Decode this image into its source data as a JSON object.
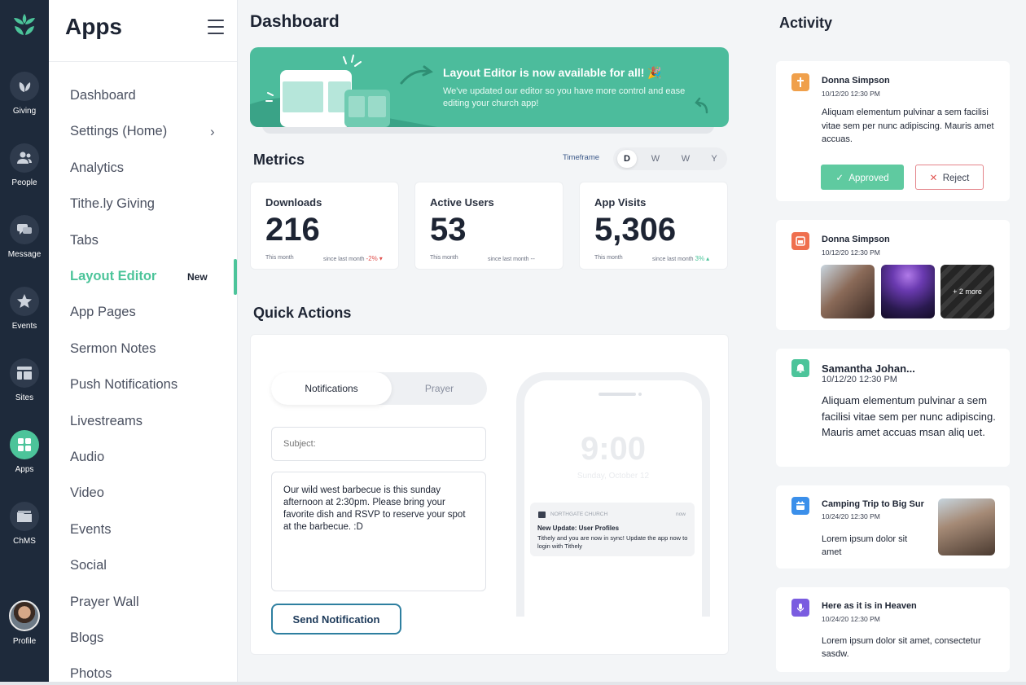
{
  "rail": {
    "items": [
      {
        "label": "Giving",
        "icon": "giving-leaf-icon"
      },
      {
        "label": "People",
        "icon": "people-icon"
      },
      {
        "label": "Message",
        "icon": "message-icon"
      },
      {
        "label": "Events",
        "icon": "events-star-icon"
      },
      {
        "label": "Sites",
        "icon": "sites-icon"
      },
      {
        "label": "Apps",
        "icon": "apps-grid-icon"
      },
      {
        "label": "ChMS",
        "icon": "chms-folder-icon"
      },
      {
        "label": "Profile",
        "icon": "profile-avatar"
      }
    ],
    "active": "Apps"
  },
  "sidebar": {
    "title": "Apps",
    "items": [
      {
        "label": "Dashboard"
      },
      {
        "label": "Settings (Home)",
        "chevron": "›"
      },
      {
        "label": "Analytics"
      },
      {
        "label": "Tithe.ly Giving"
      },
      {
        "label": "Tabs"
      },
      {
        "label": "Layout Editor",
        "badge": "New"
      },
      {
        "label": "App Pages"
      },
      {
        "label": "Sermon Notes"
      },
      {
        "label": "Push Notifications"
      },
      {
        "label": "Livestreams"
      },
      {
        "label": "Audio"
      },
      {
        "label": "Video"
      },
      {
        "label": "Events"
      },
      {
        "label": "Social"
      },
      {
        "label": "Prayer Wall"
      },
      {
        "label": "Blogs"
      },
      {
        "label": "Photos"
      }
    ],
    "active": "Layout Editor"
  },
  "main": {
    "title": "Dashboard",
    "banner": {
      "title": "Layout Editor is now available for all! 🎉",
      "text": "We've updated our editor so you have more control and ease editing your church app!"
    },
    "metrics": {
      "title": "Metrics",
      "timeframe_label": "Timeframe",
      "timeframe_options": [
        "D",
        "W",
        "W",
        "Y"
      ],
      "timeframe_selected": "D",
      "cards": [
        {
          "title": "Downloads",
          "value": "216",
          "note": "This month",
          "since": "since last month",
          "delta": "-2%",
          "arrow": "▾",
          "trend": "down"
        },
        {
          "title": "Active Users",
          "value": "53",
          "note": "This month",
          "since": "since last month",
          "delta": "",
          "arrow": "--",
          "trend": "flat"
        },
        {
          "title": "App Visits",
          "value": "5,306",
          "note": "This month",
          "since": "since last month",
          "delta": "3%",
          "arrow": "▴",
          "trend": "up"
        }
      ]
    },
    "quick_actions": {
      "title": "Quick Actions",
      "tabs": [
        "Notifications",
        "Prayer"
      ],
      "selected_tab": "Notifications",
      "subject_placeholder": "Subject:",
      "message": "Our wild west barbecue is this sunday afternoon at 2:30pm. Please bring your favorite dish and RSVP to reserve your spot at the barbecue. :D",
      "send_label": "Send Notification",
      "preview": {
        "clock": "9:00",
        "date": "Sunday, October 12",
        "church": "NORTHGATE CHURCH",
        "time": "now",
        "title": "New Update: User Profiles",
        "body": "Tithely and you are now in sync! Update the app now to login with Tithely"
      }
    }
  },
  "activity": {
    "title": "Activity",
    "items": [
      {
        "icon": "prayer-cross-icon",
        "color": "#f0a04b",
        "name": "Donna Simpson",
        "time": "10/12/20 12:30 PM",
        "body": "Aliquam elementum pulvinar a sem facilisi vitae sem per nunc adipiscing. Mauris amet accuas.",
        "approve_label": "Approved",
        "reject_label": "Reject"
      },
      {
        "icon": "photo-icon",
        "color": "#ef6f4e",
        "name": "Donna Simpson",
        "time": "10/12/20 12:30 PM",
        "more_label": "+ 2 more"
      },
      {
        "icon": "bell-icon",
        "color": "#4cc49a",
        "name": "Samantha Johan...",
        "time": "10/12/20 12:30 PM",
        "body": "Aliquam elementum pulvinar a sem facilisi vitae sem per nunc adipiscing. Mauris amet accuas msan aliq uet."
      },
      {
        "icon": "calendar-icon",
        "color": "#3b8fea",
        "name": "Camping Trip to Big Sur",
        "time": "10/24/20 12:30 PM",
        "body": "Lorem ipsum dolor sit amet"
      },
      {
        "icon": "microphone-icon",
        "color": "#7a5ce0",
        "name": "Here as it is in Heaven",
        "time": "10/24/20 12:30 PM",
        "body": "Lorem ipsum dolor sit amet, consectetur sasdw."
      }
    ]
  },
  "colors": {
    "accent": "#4cc49a",
    "rail_bg": "#1e2a3b",
    "banner_bg": "#4cbc9c",
    "negative": "#e0524f",
    "positive": "#4cc49a"
  }
}
